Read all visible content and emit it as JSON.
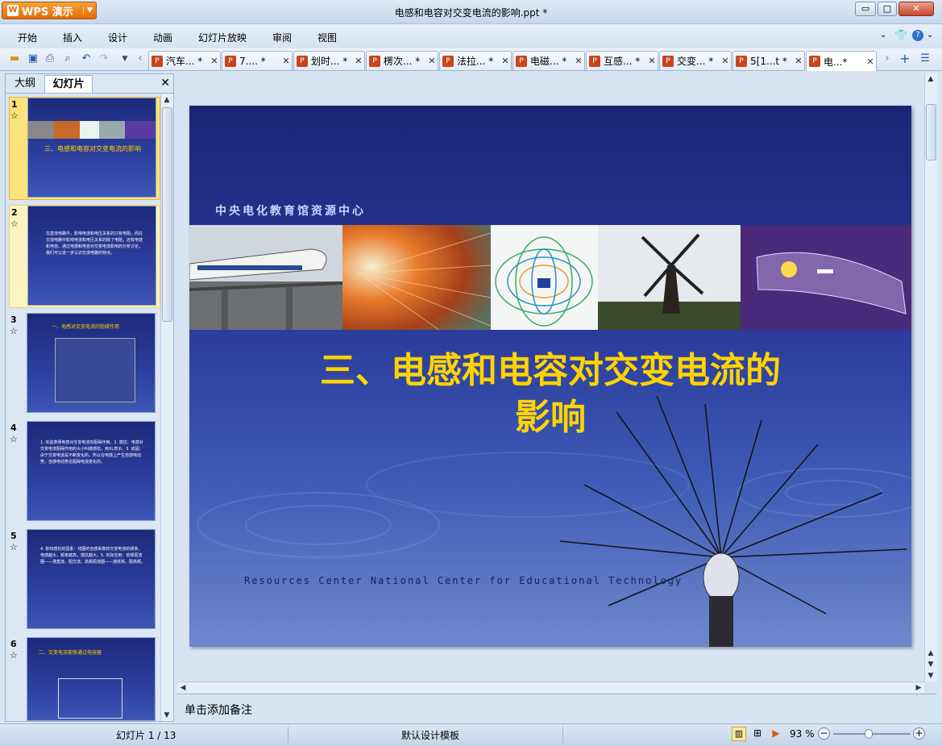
{
  "app": {
    "name": "WPS 演示",
    "title": "电感和电容对交变电流的影响.ppt *"
  },
  "window": {
    "minimize": "▭",
    "maximize": "□",
    "close": "✕"
  },
  "menu": [
    "开始",
    "插入",
    "设计",
    "动画",
    "幻灯片放映",
    "审阅",
    "视图"
  ],
  "tabs": [
    {
      "label": "汽车... *"
    },
    {
      "label": "7.... *"
    },
    {
      "label": "划时... *"
    },
    {
      "label": "楞次... *"
    },
    {
      "label": "法拉... *"
    },
    {
      "label": "电磁... *"
    },
    {
      "label": "互感... *"
    },
    {
      "label": "交变... *"
    },
    {
      "label": "5[1...t *"
    },
    {
      "label": "电...*",
      "active": true
    }
  ],
  "left_panel": {
    "tab_outline": "大纲",
    "tab_slides": "幻灯片",
    "thumbnails": [
      {
        "num": "1",
        "text": "三、电感和电容对交变电流的影响"
      },
      {
        "num": "2",
        "text": "在直流电路中，影响电流和电压关系的只有电阻，而在交流电路中影响电流和电压关系的除了电阻，还有电感和电容。通过电感和电容对交变电流影响的分析讨论，我们可以进一步认识交流电路的特点。"
      },
      {
        "num": "3",
        "text": "一、电感对交变电流的阻碍作用"
      },
      {
        "num": "4",
        "text": "1. 实验表明电感对交变电流有阻碍作用。2. 感抗：电感对交变电流阻碍作用的大小叫做感抗。用XL表示。3. 成因：由于交变电流是不断变化的，所以在电感上产生自感电动势，自感电动势总阻碍电流变化的。"
      },
      {
        "num": "5",
        "text": "4. 影响感抗的因素：线圈的自感系数和交变电流的频率。电感越大，频率越高，感抗越大。5. 实际应用：低频扼流圈——通直流，阻交流。高频扼流圈——通低频，阻高频。"
      },
      {
        "num": "6",
        "text": "二、交变电流能够通过电容器"
      }
    ]
  },
  "slide": {
    "header": "中央电化教育馆资源中心",
    "title_line1": "三、电感和电容对交变电流的",
    "title_line2": "影响",
    "footer": "Resources Center National Center for Educational Technology"
  },
  "notes_placeholder": "单击添加备注",
  "status": {
    "slide_counter": "幻灯片 1 / 13",
    "template": "默认设计模板",
    "zoom": "93 %"
  },
  "colors": {
    "title_yellow": "#ffd400",
    "slide_bg": "#2a3a98"
  }
}
